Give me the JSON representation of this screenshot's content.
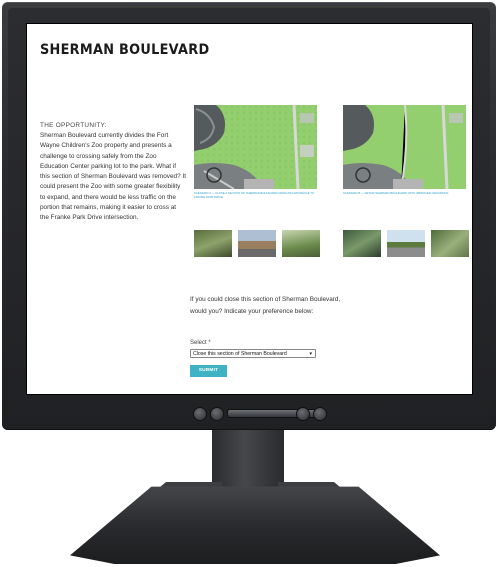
{
  "page": {
    "title": "SHERMAN BOULEVARD",
    "section_label": "THE OPPORTUNITY:",
    "body": "Sherman Boulevard currently divides the Fort Wayne Children's Zoo property and presents a challenge to crossing safely from the Zoo Education Center parking lot to the park. What if this section of Sherman Boulevard was removed? It could present the Zoo with some greater flexibility to expand, and there would be less traffic on the portion that remains, making it easier to cross at the Franke Park Drive intersection."
  },
  "figures": [
    {
      "caption": "SCENARIO A — CLOSE A SECTION OF SHERMAN BOULEVARD FROM ZOO ENTRANCE TO FRANKE PARK DRIVE"
    },
    {
      "caption": "SCENARIO B — RETAIN SHERMAN BOULEVARD WITH IMPROVED CROSSINGS"
    }
  ],
  "form": {
    "question": "If you could close this section of Sherman Boulevard, would you?  Indicate your preference below:",
    "select_label": "Select *",
    "select_value": "Close this section of Sherman Boulevard",
    "submit_label": "SUBMIT"
  },
  "colors": {
    "accent": "#3fb3c4",
    "caption": "#2aa3c7",
    "map_green": "#8cc96a"
  },
  "icons": {
    "select_caret": "caret-down-icon",
    "monitor_buttons": "power-button-icon"
  }
}
